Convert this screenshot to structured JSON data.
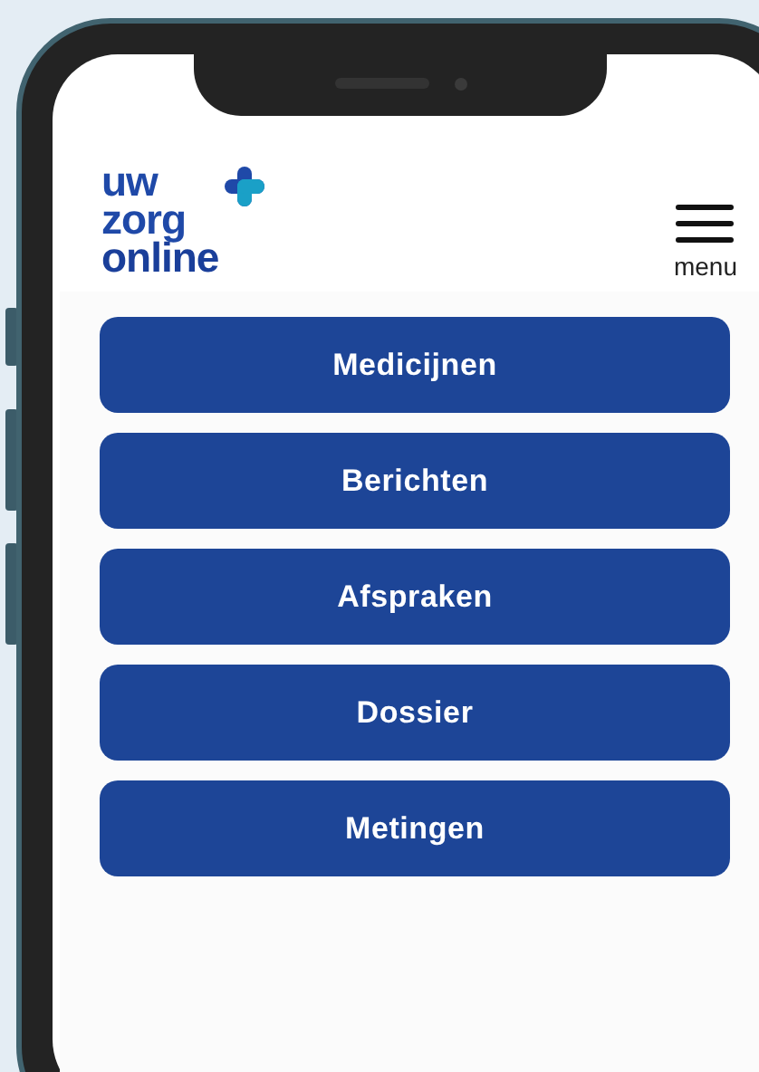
{
  "logo": {
    "lines": [
      "uw",
      "zorg",
      "online"
    ]
  },
  "menu_button": {
    "label": "menu"
  },
  "nav_buttons": [
    {
      "label": "Medicijnen"
    },
    {
      "label": "Berichten"
    },
    {
      "label": "Afspraken"
    },
    {
      "label": "Dossier"
    },
    {
      "label": "Metingen"
    }
  ]
}
